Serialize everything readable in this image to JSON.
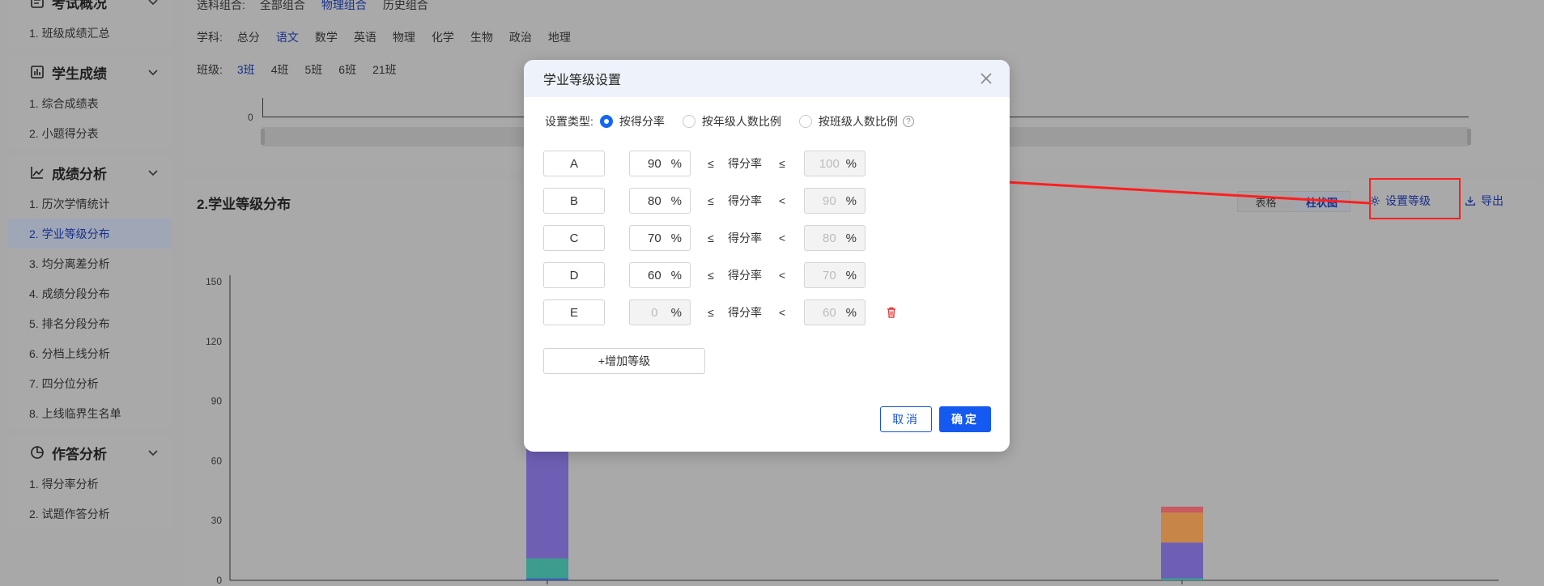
{
  "sidebar": {
    "groups": [
      {
        "title": "考试概况",
        "icon": "exam-icon",
        "items": [
          "1. 班级成绩汇总"
        ]
      },
      {
        "title": "学生成绩",
        "icon": "bar-chart-icon",
        "items": [
          "1. 综合成绩表",
          "2. 小题得分表"
        ]
      },
      {
        "title": "成绩分析",
        "icon": "line-chart-icon",
        "items": [
          "1. 历次学情统计",
          "2. 学业等级分布",
          "3. 均分离差分析",
          "4. 成绩分段分布",
          "5. 排名分段分布",
          "6. 分档上线分析",
          "7. 四分位分析",
          "8. 上线临界生名单"
        ]
      },
      {
        "title": "作答分析",
        "icon": "pie-chart-icon",
        "items": [
          "1. 得分率分析",
          "2. 试题作答分析"
        ]
      }
    ]
  },
  "filters": {
    "combo_label": "选科组合:",
    "combos": [
      "全部组合",
      "物理组合",
      "历史组合"
    ],
    "subject_label": "学科:",
    "subjects": [
      "总分",
      "语文",
      "数学",
      "英语",
      "物理",
      "化学",
      "生物",
      "政治",
      "地理"
    ],
    "class_label": "班级:",
    "classes": [
      "3班",
      "4班",
      "5班",
      "6班",
      "21班"
    ]
  },
  "slider": {
    "zero_label": "0"
  },
  "section": {
    "title": "2.学业等级分布",
    "view_table": "表格",
    "view_bar": "柱状图",
    "set_level": "设置等级",
    "export": "导出"
  },
  "chart_data": {
    "type": "bar",
    "stacked": true,
    "y_ticks": [
      "150",
      "120",
      "90",
      "60",
      "30",
      "0"
    ],
    "ylim": [
      0,
      150
    ],
    "bars": [
      {
        "segments": [
          {
            "value": 1,
            "color": "#3a5db0"
          },
          {
            "value": 10,
            "color": "#3c9c8e"
          },
          {
            "value": 108,
            "color": "#6f5fb4"
          }
        ]
      },
      {
        "segments": [
          {
            "value": 1,
            "color": "#3a9f8f"
          },
          {
            "value": 18,
            "color": "#6f5fb4"
          },
          {
            "value": 15,
            "color": "#c88548"
          },
          {
            "value": 3,
            "color": "#c85a60"
          }
        ]
      }
    ]
  },
  "modal": {
    "title": "学业等级设置",
    "type_label": "设置类型:",
    "options": [
      "按得分率",
      "按年级人数比例",
      "按班级人数比例"
    ],
    "help": "?",
    "rate_label": "得分率",
    "unit": "%",
    "grades": [
      {
        "name": "A",
        "low": "90",
        "op1": "≤",
        "op2": "≤",
        "high": "100",
        "deletable": false
      },
      {
        "name": "B",
        "low": "80",
        "op1": "≤",
        "op2": "<",
        "high": "90",
        "deletable": false
      },
      {
        "name": "C",
        "low": "70",
        "op1": "≤",
        "op2": "<",
        "high": "80",
        "deletable": false
      },
      {
        "name": "D",
        "low": "60",
        "op1": "≤",
        "op2": "<",
        "high": "70",
        "deletable": false
      },
      {
        "name": "E",
        "low": "0",
        "op1": "≤",
        "op2": "<",
        "high": "60",
        "deletable": true
      }
    ],
    "add_label": "+增加等级",
    "cancel": "取消",
    "ok": "确定"
  },
  "colors": {
    "accent": "#1459f0",
    "annotation": "#ff1f1f"
  }
}
